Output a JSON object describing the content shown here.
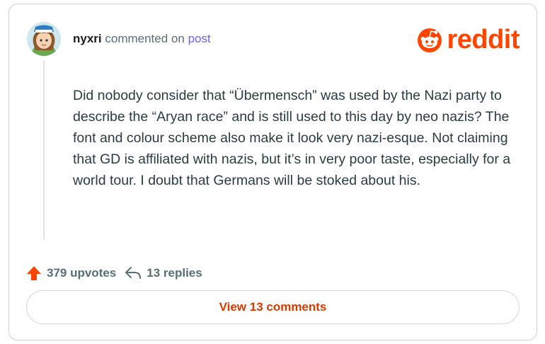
{
  "comment": {
    "username": "nyxri",
    "action_text": "commented on",
    "post_link": "post",
    "body": "Did nobody consider that “Übermensch” was used by the Nazi party to describe the “Aryan race” and is still used to this day by neo nazis? The font and colour scheme also make it look very nazi-esque. Not claiming that GD is affiliated with nazis, but it’s in very poor taste, especially for a world tour. I doubt that Germans will be stoked about his."
  },
  "brand": {
    "wordmark": "reddit",
    "color": "#ff4500"
  },
  "stats": {
    "upvotes": "379 upvotes",
    "replies": "13 replies",
    "upvote_icon": "upvote-arrow-icon",
    "reply_icon": "reply-arrow-icon",
    "upvote_color": "#ff4500"
  },
  "footer": {
    "view_comments": "View 13 comments",
    "link_color": "#d93a00"
  }
}
